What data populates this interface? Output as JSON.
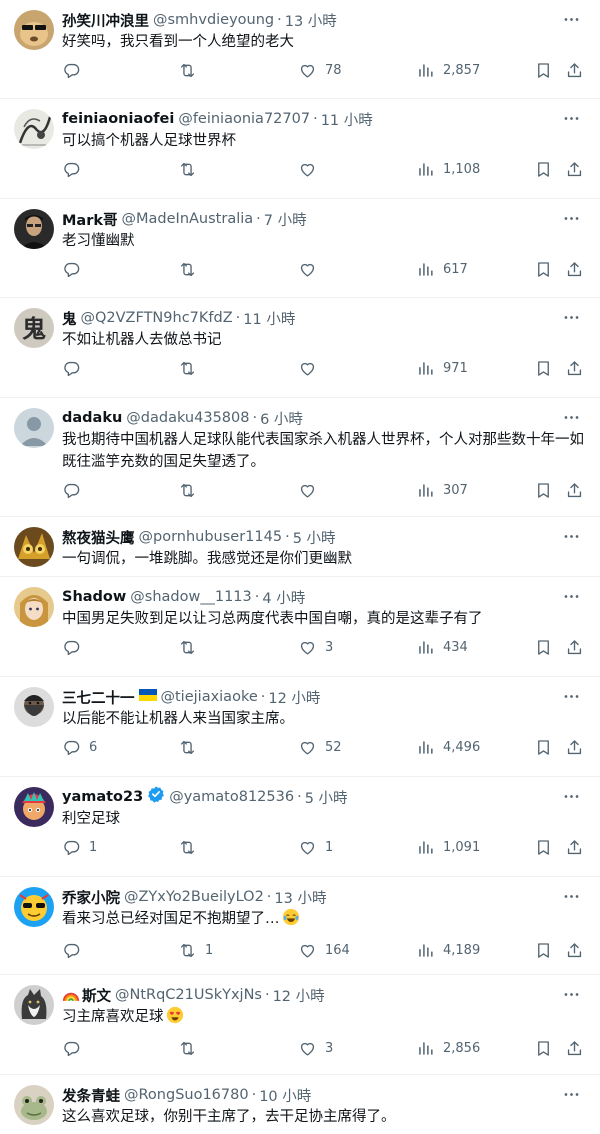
{
  "tweets": [
    {
      "name": "孙笑川冲浪里",
      "handle": "@smhvdieyoung",
      "time": "13 小時",
      "text": "好笑吗，我只看到一个人绝望的老大",
      "replies": "",
      "retweets": "",
      "likes": "78",
      "views": "2,857",
      "avatar": "shiba-avatar",
      "avatar_bg": "#c8a46e"
    },
    {
      "name": "feiniaoniaofei",
      "handle": "@feiniaonia72707",
      "time": "11 小時",
      "text": "可以搞个机器人足球世界杯",
      "replies": "",
      "retweets": "",
      "likes": "",
      "views": "1,108",
      "avatar": "ink-painting-avatar",
      "avatar_bg": "#e9e9e4"
    },
    {
      "name": "Mark哥",
      "handle": "@MadeInAustralia",
      "time": "7 小時",
      "text": "老习懂幽默",
      "replies": "",
      "retweets": "",
      "likes": "",
      "views": "617",
      "avatar": "person-photo-avatar",
      "avatar_bg": "#2a2a2a"
    },
    {
      "name": "鬼",
      "handle": "@Q2VZFTN9hc7KfdZ",
      "time": "11 小時",
      "text": "不如让机器人去做总书记",
      "replies": "",
      "retweets": "",
      "likes": "",
      "views": "971",
      "avatar": "calligraphy-avatar",
      "avatar_bg": "#cfcac0",
      "avatar_char": "鬼"
    },
    {
      "name": "dadaku",
      "handle": "@dadaku435808",
      "time": "6 小時",
      "text": "我也期待中国机器人足球队能代表国家杀入机器人世界杯，个人对那些数十年一如既往滥竽充数的国足失望透了。",
      "replies": "",
      "retweets": "",
      "likes": "",
      "views": "307",
      "avatar": "default-profile-avatar",
      "avatar_bg": "#ccd6dd"
    },
    {
      "name": "熬夜猫头鹰",
      "handle": "@pornhubuser1145",
      "time": "5 小時",
      "text": "一句调侃，一堆跳脚。我感觉还是你们更幽默",
      "replies": "",
      "retweets": "",
      "likes": "",
      "views": "",
      "avatar": "owl-avatar",
      "avatar_bg": "#6b4a1e",
      "no_actions": true
    },
    {
      "name": "Shadow",
      "handle": "@shadow__1113",
      "time": "4 小時",
      "text": "中国男足失败到足以让习总两度代表中国自嘲，真的是这辈子有了",
      "replies": "",
      "retweets": "",
      "likes": "3",
      "views": "434",
      "avatar": "anime-avatar",
      "avatar_bg": "#e6c98d"
    },
    {
      "name": "三七二十一",
      "handle": "@tiejiaxiaoke",
      "time": "12 小時",
      "text": "以后能不能让机器人来当国家主席。",
      "replies": "6",
      "retweets": "",
      "likes": "52",
      "views": "4,496",
      "avatar": "bearded-man-avatar",
      "avatar_bg": "#3a3a3a",
      "flag": true
    },
    {
      "name": "yamato23",
      "handle": "@yamato812536",
      "time": "5 小時",
      "text": "利空足球",
      "replies": "1",
      "retweets": "",
      "likes": "1",
      "views": "1,091",
      "avatar": "colorful-cartoon-avatar",
      "avatar_bg": "#3b2a5e",
      "verified": true
    },
    {
      "name": "乔家小院",
      "handle": "@ZYxYo2BueilyLO2",
      "time": "13 小時",
      "text": "看来习总已经对国足不抱期望了…",
      "replies": "",
      "retweets": "1",
      "likes": "164",
      "views": "4,189",
      "avatar": "sunglasses-emoji-avatar",
      "avatar_bg": "#1da1f2",
      "emoji": "joy-emoji"
    },
    {
      "name": "斯文",
      "handle": "@NtRqC21USkYxjNs",
      "time": "12 小時",
      "text": "习主席喜欢足球",
      "replies": "",
      "retweets": "",
      "likes": "3",
      "views": "2,856",
      "avatar": "cat-avatar",
      "avatar_bg": "#8a8a8a",
      "rainbow": true,
      "emoji": "heart-eyes-emoji"
    },
    {
      "name": "发条青蛙",
      "handle": "@RongSuo16780",
      "time": "10 小時",
      "text": "这么喜欢足球，你别干主席了，去干足协主席得了。",
      "replies": "",
      "retweets": "",
      "likes": "",
      "views": "",
      "avatar": "frog-avatar",
      "avatar_bg": "#d9d2c2",
      "no_actions": true
    }
  ],
  "colors": {
    "text": "#0f1419",
    "secondary": "#536471",
    "verified": "#1d9bf0",
    "divider": "#eff3f4"
  }
}
